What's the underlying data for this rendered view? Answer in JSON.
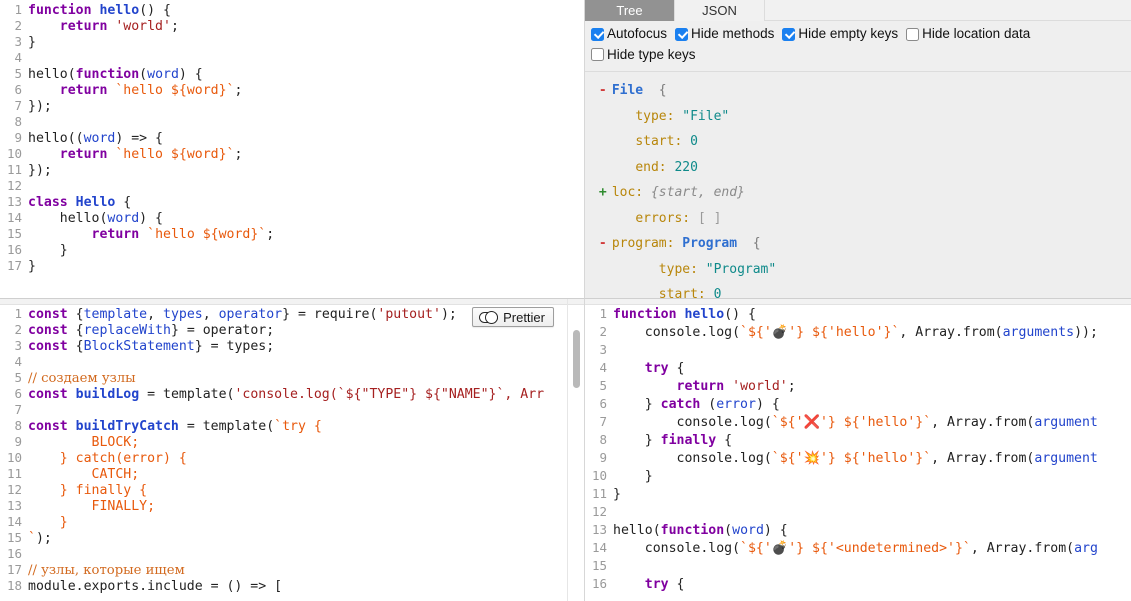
{
  "app": {
    "title": "putout AST explorer"
  },
  "top_left_editor": {
    "name": "source-code-editor",
    "language": "javascript",
    "lines": [
      {
        "n": 1,
        "tokens": [
          {
            "t": "function",
            "c": "kw"
          },
          {
            "t": " ",
            "c": "plain"
          },
          {
            "t": "hello",
            "c": "fn"
          },
          {
            "t": "() {",
            "c": "plain"
          }
        ]
      },
      {
        "n": 2,
        "tokens": [
          {
            "t": "    ",
            "c": "plain"
          },
          {
            "t": "return",
            "c": "kw"
          },
          {
            "t": " ",
            "c": "plain"
          },
          {
            "t": "'world'",
            "c": "str"
          },
          {
            "t": ";",
            "c": "plain"
          }
        ]
      },
      {
        "n": 3,
        "tokens": [
          {
            "t": "}",
            "c": "plain"
          }
        ]
      },
      {
        "n": 4,
        "tokens": []
      },
      {
        "n": 5,
        "tokens": [
          {
            "t": "hello(",
            "c": "plain"
          },
          {
            "t": "function",
            "c": "kw"
          },
          {
            "t": "(",
            "c": "plain"
          },
          {
            "t": "word",
            "c": "var"
          },
          {
            "t": ") {",
            "c": "plain"
          }
        ]
      },
      {
        "n": 6,
        "tokens": [
          {
            "t": "    ",
            "c": "plain"
          },
          {
            "t": "return",
            "c": "kw"
          },
          {
            "t": " ",
            "c": "plain"
          },
          {
            "t": "`hello ${word}`",
            "c": "tpl"
          },
          {
            "t": ";",
            "c": "plain"
          }
        ]
      },
      {
        "n": 7,
        "tokens": [
          {
            "t": "});",
            "c": "plain"
          }
        ]
      },
      {
        "n": 8,
        "tokens": []
      },
      {
        "n": 9,
        "tokens": [
          {
            "t": "hello((",
            "c": "plain"
          },
          {
            "t": "word",
            "c": "var"
          },
          {
            "t": ") => {",
            "c": "plain"
          }
        ]
      },
      {
        "n": 10,
        "tokens": [
          {
            "t": "    ",
            "c": "plain"
          },
          {
            "t": "return",
            "c": "kw"
          },
          {
            "t": " ",
            "c": "plain"
          },
          {
            "t": "`hello ${word}`",
            "c": "tpl"
          },
          {
            "t": ";",
            "c": "plain"
          }
        ]
      },
      {
        "n": 11,
        "tokens": [
          {
            "t": "});",
            "c": "plain"
          }
        ]
      },
      {
        "n": 12,
        "tokens": []
      },
      {
        "n": 13,
        "tokens": [
          {
            "t": "class",
            "c": "kw"
          },
          {
            "t": " ",
            "c": "plain"
          },
          {
            "t": "Hello",
            "c": "fn"
          },
          {
            "t": " {",
            "c": "plain"
          }
        ]
      },
      {
        "n": 14,
        "tokens": [
          {
            "t": "    hello(",
            "c": "plain"
          },
          {
            "t": "word",
            "c": "var"
          },
          {
            "t": ") {",
            "c": "plain"
          }
        ]
      },
      {
        "n": 15,
        "tokens": [
          {
            "t": "        ",
            "c": "plain"
          },
          {
            "t": "return",
            "c": "kw"
          },
          {
            "t": " ",
            "c": "plain"
          },
          {
            "t": "`hello ${word}`",
            "c": "tpl"
          },
          {
            "t": ";",
            "c": "plain"
          }
        ]
      },
      {
        "n": 16,
        "tokens": [
          {
            "t": "    }",
            "c": "plain"
          }
        ]
      },
      {
        "n": 17,
        "tokens": [
          {
            "t": "}",
            "c": "plain"
          }
        ]
      }
    ]
  },
  "tree_panel": {
    "tabs": [
      {
        "label": "Tree",
        "active": true
      },
      {
        "label": "JSON",
        "active": false
      }
    ],
    "options": [
      {
        "label": "Autofocus",
        "checked": true
      },
      {
        "label": "Hide methods",
        "checked": true
      },
      {
        "label": "Hide empty keys",
        "checked": true
      },
      {
        "label": "Hide location data",
        "checked": false
      },
      {
        "label": "Hide type keys",
        "checked": false
      }
    ],
    "rows": [
      {
        "indent": 0,
        "toggle": "-",
        "parts": [
          {
            "t": "File",
            "c": "tname"
          },
          {
            "t": "  {",
            "c": "tbrace"
          }
        ]
      },
      {
        "indent": 1,
        "toggle": "",
        "parts": [
          {
            "t": "type:",
            "c": "tkey"
          },
          {
            "t": " ",
            "c": "plain"
          },
          {
            "t": "\"File\"",
            "c": "tstr"
          }
        ]
      },
      {
        "indent": 1,
        "toggle": "",
        "parts": [
          {
            "t": "start:",
            "c": "tkey"
          },
          {
            "t": " ",
            "c": "plain"
          },
          {
            "t": "0",
            "c": "tnum"
          }
        ]
      },
      {
        "indent": 1,
        "toggle": "",
        "parts": [
          {
            "t": "end:",
            "c": "tkey"
          },
          {
            "t": " ",
            "c": "plain"
          },
          {
            "t": "220",
            "c": "tnum"
          }
        ]
      },
      {
        "indent": 0,
        "toggle": "+",
        "parts": [
          {
            "t": "loc:",
            "c": "tkey"
          },
          {
            "t": " ",
            "c": "plain"
          },
          {
            "t": "{start, end}",
            "c": "tplaceholder"
          }
        ]
      },
      {
        "indent": 1,
        "toggle": "",
        "parts": [
          {
            "t": "errors:",
            "c": "tkey"
          },
          {
            "t": " ",
            "c": "plain"
          },
          {
            "t": "[ ]",
            "c": "tmuted"
          }
        ]
      },
      {
        "indent": 0,
        "toggle": "-",
        "parts": [
          {
            "t": "program:",
            "c": "tkey"
          },
          {
            "t": " ",
            "c": "plain"
          },
          {
            "t": "Program",
            "c": "tname"
          },
          {
            "t": "  {",
            "c": "tbrace"
          }
        ]
      },
      {
        "indent": 2,
        "toggle": "",
        "parts": [
          {
            "t": "type:",
            "c": "tkey"
          },
          {
            "t": " ",
            "c": "plain"
          },
          {
            "t": "\"Program\"",
            "c": "tstr"
          }
        ]
      },
      {
        "indent": 2,
        "toggle": "",
        "parts": [
          {
            "t": "start:",
            "c": "tkey"
          },
          {
            "t": " ",
            "c": "plain"
          },
          {
            "t": "0",
            "c": "tnum"
          }
        ]
      }
    ]
  },
  "bottom_left_editor": {
    "name": "plugin-code-editor",
    "prettier_label": "Prettier",
    "prettier_enabled": false,
    "lines": [
      {
        "n": 1,
        "tokens": [
          {
            "t": "const",
            "c": "kw"
          },
          {
            "t": " {",
            "c": "plain"
          },
          {
            "t": "template",
            "c": "var"
          },
          {
            "t": ", ",
            "c": "plain"
          },
          {
            "t": "types",
            "c": "var"
          },
          {
            "t": ", ",
            "c": "plain"
          },
          {
            "t": "operator",
            "c": "var"
          },
          {
            "t": "} = require(",
            "c": "plain"
          },
          {
            "t": "'putout'",
            "c": "str"
          },
          {
            "t": ");",
            "c": "plain"
          }
        ]
      },
      {
        "n": 2,
        "tokens": [
          {
            "t": "const",
            "c": "kw"
          },
          {
            "t": " {",
            "c": "plain"
          },
          {
            "t": "replaceWith",
            "c": "var"
          },
          {
            "t": "} = operator;",
            "c": "plain"
          }
        ]
      },
      {
        "n": 3,
        "tokens": [
          {
            "t": "const",
            "c": "kw"
          },
          {
            "t": " {",
            "c": "plain"
          },
          {
            "t": "BlockStatement",
            "c": "var"
          },
          {
            "t": "} = types;",
            "c": "plain"
          }
        ]
      },
      {
        "n": 4,
        "tokens": []
      },
      {
        "n": 5,
        "tokens": [
          {
            "t": "// создаем узлы",
            "c": "cmt"
          }
        ]
      },
      {
        "n": 6,
        "tokens": [
          {
            "t": "const",
            "c": "kw"
          },
          {
            "t": " ",
            "c": "plain"
          },
          {
            "t": "buildLog",
            "c": "fn"
          },
          {
            "t": " = template(",
            "c": "plain"
          },
          {
            "t": "'console.log(`${\"TYPE\"} ${\"NAME\"}`, Arr",
            "c": "str"
          }
        ]
      },
      {
        "n": 7,
        "tokens": []
      },
      {
        "n": 8,
        "tokens": [
          {
            "t": "const",
            "c": "kw"
          },
          {
            "t": " ",
            "c": "plain"
          },
          {
            "t": "buildTryCatch",
            "c": "fn"
          },
          {
            "t": " = template(",
            "c": "plain"
          },
          {
            "t": "`try {",
            "c": "tpl"
          }
        ]
      },
      {
        "n": 9,
        "tokens": [
          {
            "t": "        BLOCK;",
            "c": "tpl"
          }
        ]
      },
      {
        "n": 10,
        "tokens": [
          {
            "t": "    } catch(error) {",
            "c": "tpl"
          }
        ]
      },
      {
        "n": 11,
        "tokens": [
          {
            "t": "        CATCH;",
            "c": "tpl"
          }
        ]
      },
      {
        "n": 12,
        "tokens": [
          {
            "t": "    } finally {",
            "c": "tpl"
          }
        ]
      },
      {
        "n": 13,
        "tokens": [
          {
            "t": "        FINALLY;",
            "c": "tpl"
          }
        ]
      },
      {
        "n": 14,
        "tokens": [
          {
            "t": "    }",
            "c": "tpl"
          }
        ]
      },
      {
        "n": 15,
        "tokens": [
          {
            "t": "`",
            "c": "tpl"
          },
          {
            "t": ");",
            "c": "plain"
          }
        ]
      },
      {
        "n": 16,
        "tokens": []
      },
      {
        "n": 17,
        "tokens": [
          {
            "t": "// узлы, которые ищем",
            "c": "cmt"
          }
        ]
      },
      {
        "n": 18,
        "tokens": [
          {
            "t": "module.exports.include = () => [",
            "c": "plain"
          }
        ]
      }
    ]
  },
  "bottom_right_editor": {
    "name": "transformed-output-editor",
    "lines": [
      {
        "n": 1,
        "tokens": [
          {
            "t": "function",
            "c": "kw"
          },
          {
            "t": " ",
            "c": "plain"
          },
          {
            "t": "hello",
            "c": "fn"
          },
          {
            "t": "() {",
            "c": "plain"
          }
        ]
      },
      {
        "n": 2,
        "tokens": [
          {
            "t": "    console.log(",
            "c": "plain"
          },
          {
            "t": "`${'",
            "c": "tpl"
          },
          {
            "t": "💣",
            "c": "emoji"
          },
          {
            "t": "'} ${'hello'}`",
            "c": "tpl"
          },
          {
            "t": ", Array.from(",
            "c": "plain"
          },
          {
            "t": "arguments",
            "c": "var"
          },
          {
            "t": "));",
            "c": "plain"
          }
        ]
      },
      {
        "n": 3,
        "tokens": []
      },
      {
        "n": 4,
        "tokens": [
          {
            "t": "    ",
            "c": "plain"
          },
          {
            "t": "try",
            "c": "kw"
          },
          {
            "t": " {",
            "c": "plain"
          }
        ]
      },
      {
        "n": 5,
        "tokens": [
          {
            "t": "        ",
            "c": "plain"
          },
          {
            "t": "return",
            "c": "kw"
          },
          {
            "t": " ",
            "c": "plain"
          },
          {
            "t": "'world'",
            "c": "str"
          },
          {
            "t": ";",
            "c": "plain"
          }
        ]
      },
      {
        "n": 6,
        "tokens": [
          {
            "t": "    } ",
            "c": "plain"
          },
          {
            "t": "catch",
            "c": "kw"
          },
          {
            "t": " (",
            "c": "plain"
          },
          {
            "t": "error",
            "c": "var"
          },
          {
            "t": ") {",
            "c": "plain"
          }
        ]
      },
      {
        "n": 7,
        "tokens": [
          {
            "t": "        console.log(",
            "c": "plain"
          },
          {
            "t": "`${'",
            "c": "tpl"
          },
          {
            "t": "❌",
            "c": "emoji"
          },
          {
            "t": "'} ${'hello'}`",
            "c": "tpl"
          },
          {
            "t": ", Array.from(",
            "c": "plain"
          },
          {
            "t": "argument",
            "c": "var"
          }
        ]
      },
      {
        "n": 8,
        "tokens": [
          {
            "t": "    } ",
            "c": "plain"
          },
          {
            "t": "finally",
            "c": "kw"
          },
          {
            "t": " {",
            "c": "plain"
          }
        ]
      },
      {
        "n": 9,
        "tokens": [
          {
            "t": "        console.log(",
            "c": "plain"
          },
          {
            "t": "`${'",
            "c": "tpl"
          },
          {
            "t": "💥",
            "c": "emoji"
          },
          {
            "t": "'} ${'hello'}`",
            "c": "tpl"
          },
          {
            "t": ", Array.from(",
            "c": "plain"
          },
          {
            "t": "argument",
            "c": "var"
          }
        ]
      },
      {
        "n": 10,
        "tokens": [
          {
            "t": "    }",
            "c": "plain"
          }
        ]
      },
      {
        "n": 11,
        "tokens": [
          {
            "t": "}",
            "c": "plain"
          }
        ]
      },
      {
        "n": 12,
        "tokens": []
      },
      {
        "n": 13,
        "tokens": [
          {
            "t": "hello(",
            "c": "plain"
          },
          {
            "t": "function",
            "c": "kw"
          },
          {
            "t": "(",
            "c": "plain"
          },
          {
            "t": "word",
            "c": "var"
          },
          {
            "t": ") {",
            "c": "plain"
          }
        ]
      },
      {
        "n": 14,
        "tokens": [
          {
            "t": "    console.log(",
            "c": "plain"
          },
          {
            "t": "`${'",
            "c": "tpl"
          },
          {
            "t": "💣",
            "c": "emoji"
          },
          {
            "t": "'} ${'<undetermined>'}`",
            "c": "tpl"
          },
          {
            "t": ", Array.from(",
            "c": "plain"
          },
          {
            "t": "arg",
            "c": "var"
          }
        ]
      },
      {
        "n": 15,
        "tokens": []
      },
      {
        "n": 16,
        "tokens": [
          {
            "t": "    ",
            "c": "plain"
          },
          {
            "t": "try",
            "c": "kw"
          },
          {
            "t": " {",
            "c": "plain"
          }
        ]
      }
    ]
  },
  "colors": {
    "keyword": "#8000a0",
    "function": "#2244cc",
    "string": "#a52020",
    "template": "#e8590c",
    "comment": "#d2691e",
    "tree_key": "#b8860b",
    "tree_name": "#2f6fd0",
    "tree_value": "#0f8a8a",
    "checkbox_on": "#1a80f0",
    "active_tab_bg": "#929292"
  }
}
